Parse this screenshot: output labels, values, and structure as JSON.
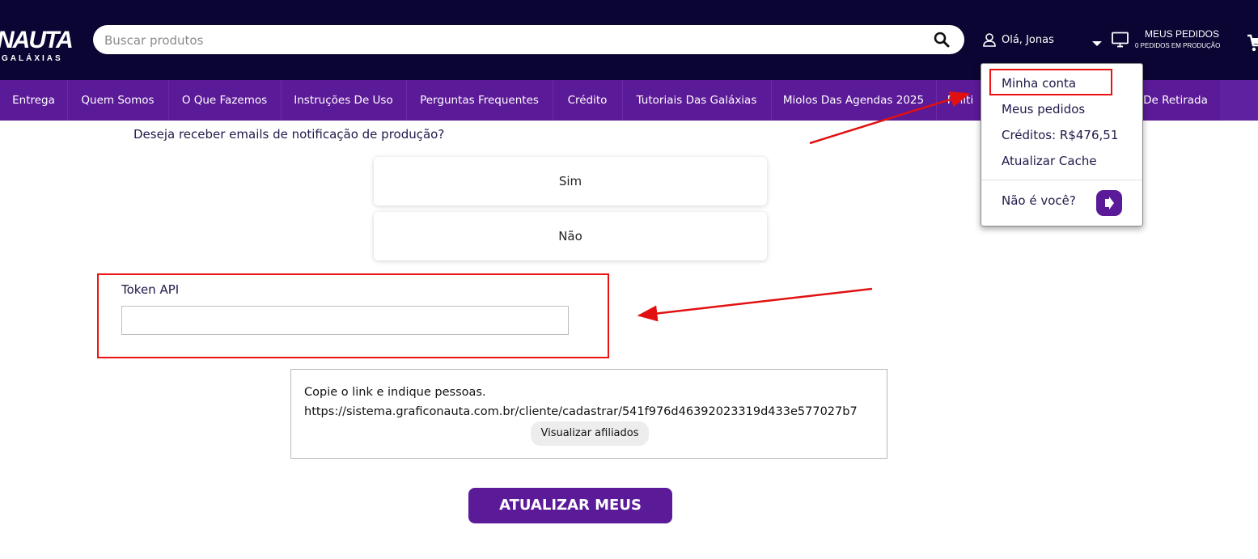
{
  "brand": {
    "logo_main": "NAUTA",
    "logo_sub": "GALÁXIAS"
  },
  "search": {
    "placeholder": "Buscar produtos",
    "icon": "search-icon"
  },
  "header": {
    "greeting": "Olá, Jonas",
    "orders_title": "MEUS PEDIDOS",
    "orders_subtitle": "0 PEDIDOS EM PRODUÇÃO"
  },
  "nav": {
    "items": [
      "Entrega",
      "Quem Somos",
      "O Que Fazemos",
      "Instruções De Uso",
      "Perguntas Frequentes",
      "Crédito",
      "Tutoriais Das Galáxias",
      "Miolos Das Agendas 2025",
      "Políti",
      "De Retirada"
    ]
  },
  "form": {
    "question": "Deseja receber emails de notificação de produção?",
    "options": [
      "Sim",
      "Não"
    ],
    "token_label": "Token API",
    "token_value": ""
  },
  "referral": {
    "text": "Copie o link e indique pessoas.",
    "link": "https://sistema.graficonauta.com.br/cliente/cadastrar/541f976d46392023319d433e577027b7",
    "button": "Visualizar afiliados"
  },
  "submit_label": "ATUALIZAR MEUS DADOS",
  "dropdown": {
    "items": [
      "Minha conta",
      "Meus pedidos",
      "Créditos: R$476,51",
      "Atualizar Cache"
    ],
    "not_you": "Não é você?"
  },
  "colors": {
    "header_bg": "#0b0533",
    "nav_bg": "#5b1a97",
    "accent": "#5b1a97",
    "annotation_red": "#e11111"
  }
}
